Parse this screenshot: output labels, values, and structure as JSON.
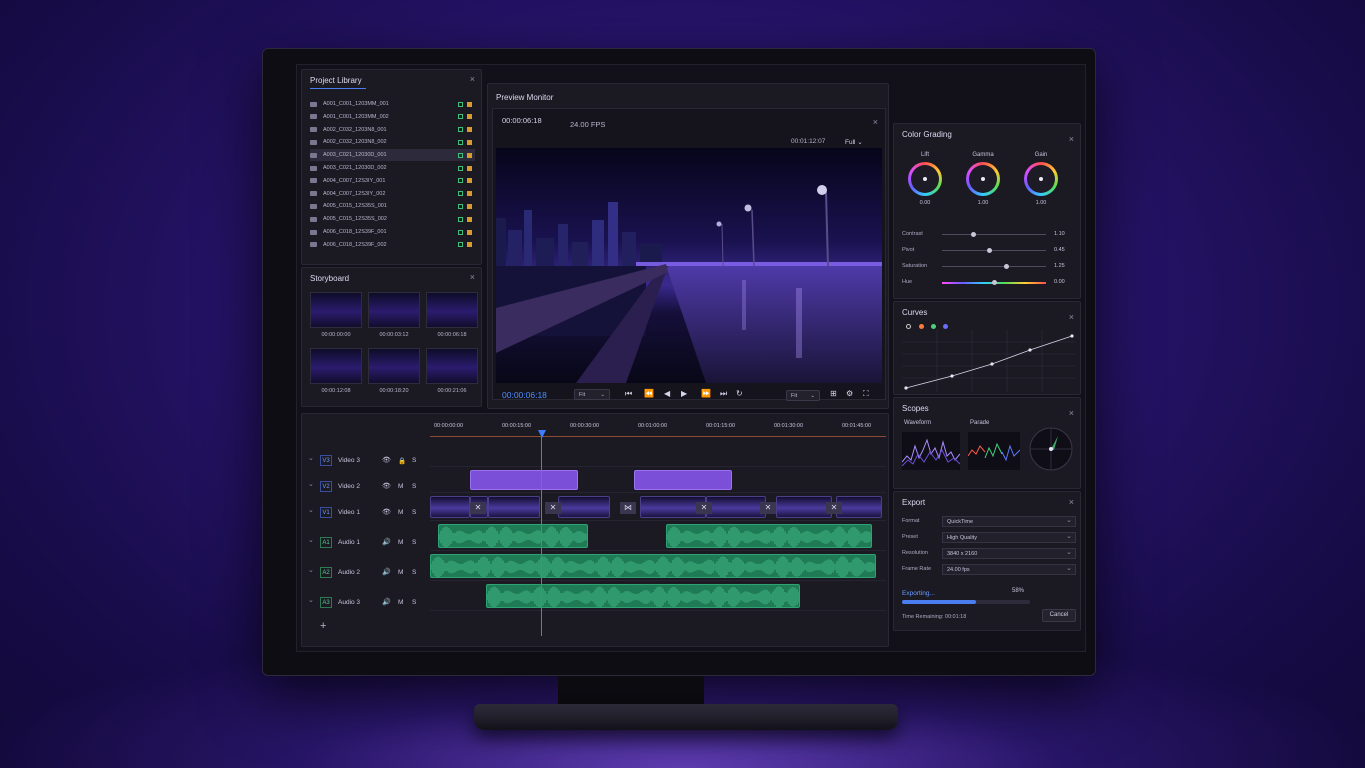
{
  "project_library": {
    "title": "Project Library",
    "items": [
      "A001_C001_1203MM_001",
      "A001_C001_1203MM_002",
      "A002_C032_1203N8_001",
      "A002_C032_1203N8_002",
      "A003_C021_12030D_001",
      "A003_C021_12030D_002",
      "A004_C007_12S3IY_001",
      "A004_C007_12S3IY_002",
      "A005_C015_12S35S_001",
      "A005_C015_12S35S_002",
      "A006_C018_12S39F_001",
      "A006_C018_12S39F_002"
    ],
    "selected_index": 4
  },
  "storyboard": {
    "title": "Storyboard",
    "thumbs": [
      "00:00:00:00",
      "00:00:03:12",
      "00:00:06:18",
      "00:00:12:08",
      "00:00:18:20",
      "00:00:21:06"
    ]
  },
  "preview": {
    "title": "Preview Monitor",
    "timecode": "00:00:06:18",
    "fps": "24.00 FPS",
    "duration": "00:01:12:07",
    "quality": "Full",
    "current_tc": "00:00:06:18",
    "fit_left": "Fit",
    "fit_right": "Fit"
  },
  "timeline": {
    "ruler": [
      "00:00:00:00",
      "00:00:15:00",
      "00:00:30:00",
      "00:01:00:00",
      "00:01:15:00",
      "00:01:30:00",
      "00:01:45:00"
    ],
    "tracks": [
      {
        "id": "V3",
        "name": "Video 3",
        "mode": "🔒",
        "s": "S",
        "type": "vid"
      },
      {
        "id": "V2",
        "name": "Video 2",
        "mode": "M",
        "s": "S",
        "type": "vid"
      },
      {
        "id": "V1",
        "name": "Video 1",
        "mode": "M",
        "s": "S",
        "type": "vid"
      },
      {
        "id": "A1",
        "name": "Audio 1",
        "mode": "M",
        "s": "S",
        "type": "aud"
      },
      {
        "id": "A2",
        "name": "Audio 2",
        "mode": "M",
        "s": "S",
        "type": "aud"
      },
      {
        "id": "A3",
        "name": "Audio 3",
        "mode": "M",
        "s": "S",
        "type": "aud"
      }
    ],
    "add_label": "+"
  },
  "color_grading": {
    "title": "Color Grading",
    "wheels": [
      {
        "label": "Lift",
        "value": "0.00"
      },
      {
        "label": "Gamma",
        "value": "1.00"
      },
      {
        "label": "Gain",
        "value": "1.00"
      }
    ],
    "sliders": [
      {
        "label": "Contrast",
        "value": "1.10",
        "level": 0.3
      },
      {
        "label": "Pivot",
        "value": "0.45",
        "level": 0.45
      },
      {
        "label": "Saturation",
        "value": "1.25",
        "level": 0.62
      },
      {
        "label": "Hue",
        "value": "0.00",
        "level": 0.5
      }
    ]
  },
  "curves": {
    "title": "Curves"
  },
  "scopes": {
    "title": "Scopes",
    "waveform": "Waveform",
    "parade": "Parade"
  },
  "export": {
    "title": "Export",
    "fields": [
      {
        "label": "Format",
        "value": "QuickTime"
      },
      {
        "label": "Preset",
        "value": "High Quality"
      },
      {
        "label": "Resolution",
        "value": "3840 x 2160"
      },
      {
        "label": "Frame Rate",
        "value": "24.00 fps"
      }
    ],
    "status": "Exporting...",
    "progress_percent": "58%",
    "progress": 0.58,
    "remaining": "Time Remaining: 00:01:18",
    "cancel": "Cancel"
  },
  "colors": {
    "accent": "#4a7ef0",
    "video_clip": "#7b4fd8",
    "audio_clip": "#1f7a56",
    "playhead": "#3d7dff"
  }
}
